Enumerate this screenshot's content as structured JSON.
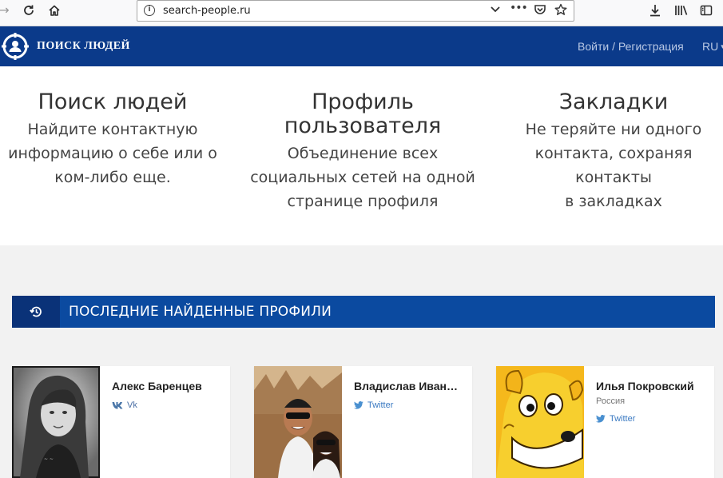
{
  "browser": {
    "url": "search-people.ru"
  },
  "header": {
    "logo_text": "ПОИСК ЛЮДЕЙ",
    "login_link": "Войти / Регистрация",
    "language": "RU",
    "brand_color": "#0b3a8a"
  },
  "features": [
    {
      "title": "Поиск людей",
      "lines": [
        "Найдите контактную",
        "информацию о себе или о",
        "ком-либо еще."
      ]
    },
    {
      "title_lines": [
        "Профиль",
        "пользователя"
      ],
      "lines": [
        "Объединение всех",
        "социальных сетей на одной",
        "странице профиля"
      ]
    },
    {
      "title": "Закладки",
      "lines": [
        "Не теряйте ни одного",
        "контакта, сохраняя контакты",
        "в закладках"
      ]
    }
  ],
  "recent_section": {
    "title": "ПОСЛЕДНИЕ НАЙДЕННЫЕ ПРОФИЛИ",
    "icon": "history-icon",
    "color": "#0b4aa0"
  },
  "profiles": [
    {
      "name": "Алекс Баренцев",
      "network": "Vk",
      "network_icon": "vk-icon"
    },
    {
      "name": "Владислав Иван…",
      "network": "Twitter",
      "network_icon": "twitter-icon"
    },
    {
      "name": "Илья Покровский",
      "country": "Россия",
      "network": "Twitter",
      "network_icon": "twitter-icon"
    }
  ]
}
